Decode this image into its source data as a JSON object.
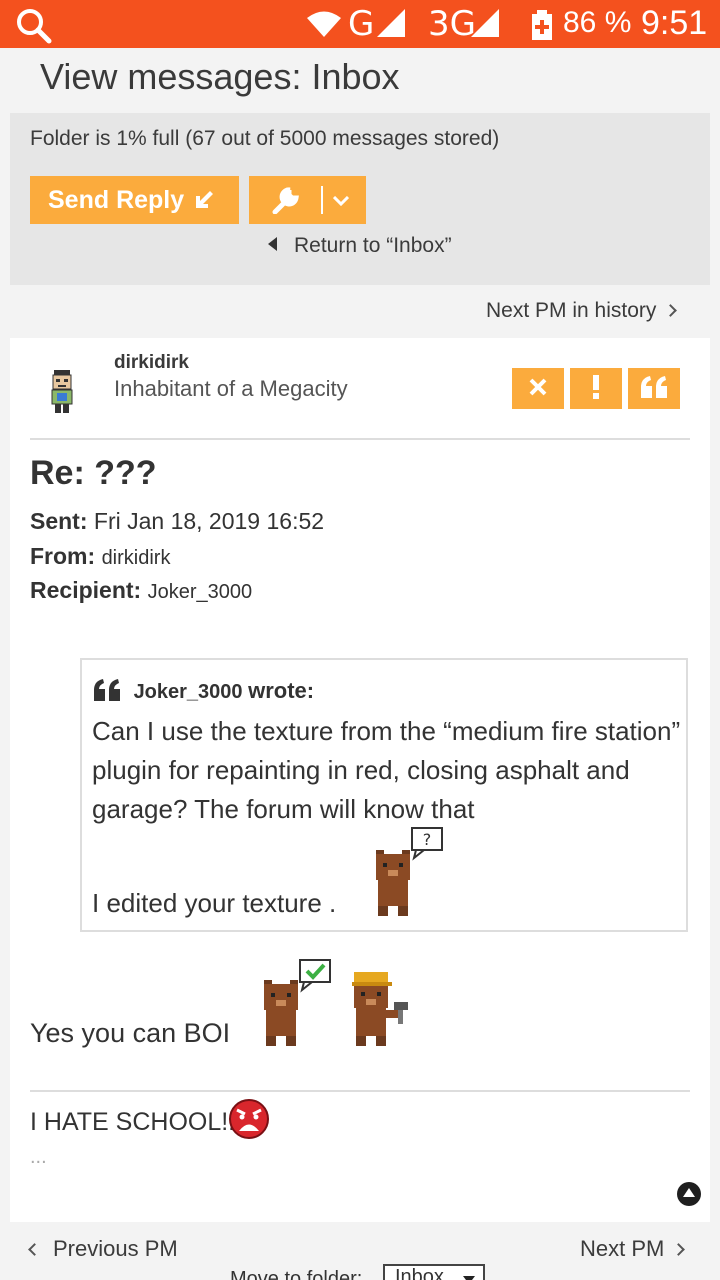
{
  "status_bar": {
    "network_1": "G",
    "network_2": "3G",
    "battery": "86 %",
    "time": "9:51",
    "icons": [
      "search-icon",
      "wifi-icon",
      "signal-icon",
      "battery-icon"
    ]
  },
  "page": {
    "title": "View messages: Inbox"
  },
  "folder": {
    "info": "Folder is 1% full (67 out of 5000 messages stored)",
    "send_reply_label": "Send Reply",
    "return_link": "Return to “Inbox”"
  },
  "navigation": {
    "next_history": "Next PM in history",
    "previous_pm": "Previous PM",
    "next_pm": "Next PM",
    "move_label": "Move to folder:",
    "move_value": "Inbox"
  },
  "message": {
    "author": "dirkidirk",
    "author_rank": "Inhabitant of a Megacity",
    "subject": "Re: ???",
    "sent_label": "Sent:",
    "sent_value": "Fri Jan 18, 2019 16:52",
    "from_label": "From:",
    "from_value": "dirkidirk",
    "recipient_label": "Recipient:",
    "recipient_value": "Joker_3000",
    "quote": {
      "author": "Joker_3000",
      "wrote": "wrote:",
      "body": "Can I use the texture from the “medium fire station” plugin for repainting in red, closing asphalt and garage? The forum will know that",
      "last_line": "I edited your texture ."
    },
    "reply": "Yes you can BOI",
    "signature": "I HATE SCHOOL!!",
    "ellipsis": "..."
  },
  "colors": {
    "accent_orange": "#f4511e",
    "button_orange": "#fbab3d"
  }
}
